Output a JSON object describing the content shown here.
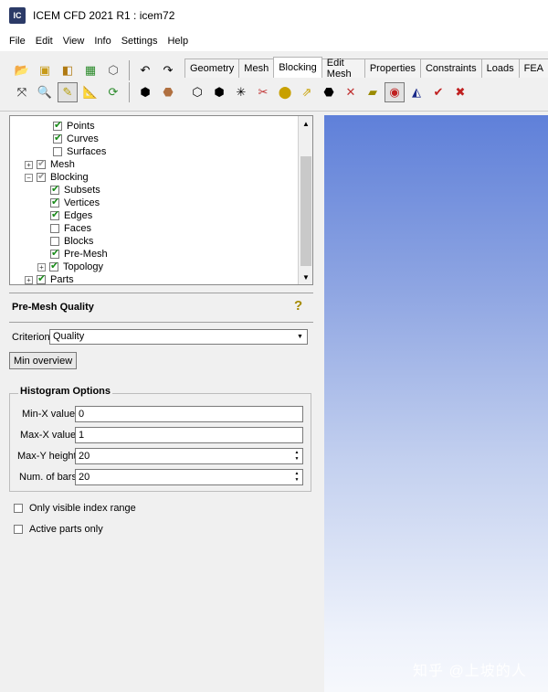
{
  "window": {
    "title": "ICEM CFD 2021 R1 : icem72",
    "app_icon_text": "IC"
  },
  "menu": [
    "File",
    "Edit",
    "View",
    "Info",
    "Settings",
    "Help"
  ],
  "tabs": [
    "Geometry",
    "Mesh",
    "Blocking",
    "Edit Mesh",
    "Properties",
    "Constraints",
    "Loads",
    "FEA"
  ],
  "active_tab": "Blocking",
  "tree": [
    {
      "label": "Points",
      "checked": true
    },
    {
      "label": "Curves",
      "checked": true
    },
    {
      "label": "Surfaces",
      "checked": false
    },
    {
      "label": "Mesh",
      "checked": "partial"
    },
    {
      "label": "Blocking",
      "checked": "partial"
    },
    {
      "label": "Subsets",
      "checked": true
    },
    {
      "label": "Vertices",
      "checked": true
    },
    {
      "label": "Edges",
      "checked": true
    },
    {
      "label": "Faces",
      "checked": false
    },
    {
      "label": "Blocks",
      "checked": false
    },
    {
      "label": "Pre-Mesh",
      "checked": true
    },
    {
      "label": "Topology",
      "checked": true
    },
    {
      "label": "Parts",
      "checked": true
    }
  ],
  "panel": {
    "title": "Pre-Mesh Quality",
    "criterion_label": "Criterion",
    "criterion_value": "Quality",
    "min_overview_button": "Min overview",
    "histogram_title": "Histogram Options",
    "min_x_label": "Min-X value",
    "min_x_value": "0",
    "max_x_label": "Max-X value",
    "max_x_value": "1",
    "max_y_label": "Max-Y height",
    "max_y_value": "20",
    "num_bars_label": "Num. of bars",
    "num_bars_value": "20",
    "only_visible_label": "Only visible index range",
    "active_parts_label": "Active parts only"
  },
  "watermark": "知乎 @上坡的人",
  "colors": {
    "viewport_top": "#5f80d9",
    "viewport_bottom": "#f6f8fc",
    "check_green": "#1a8c1a"
  }
}
